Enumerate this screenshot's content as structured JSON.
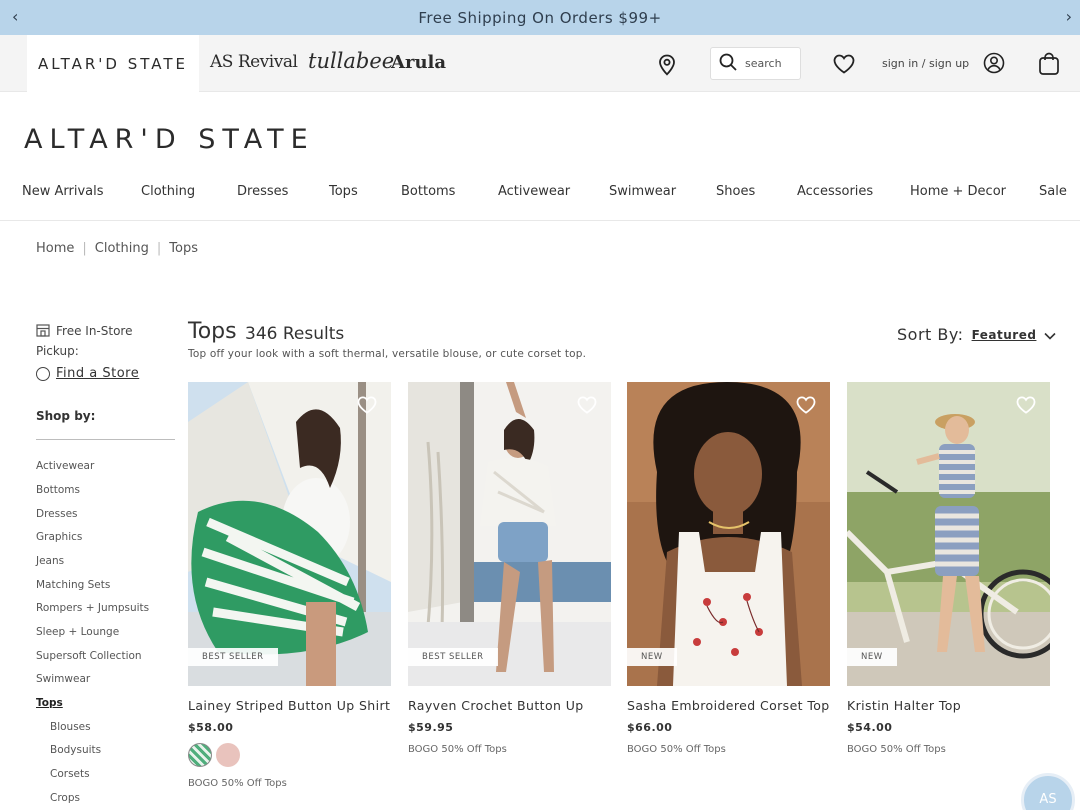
{
  "promo": {
    "text": "Free Shipping On Orders $99+",
    "prev_icon": "chevron-left-icon",
    "next_icon": "chevron-right-icon"
  },
  "brands": {
    "active": "ALTAR'D STATE",
    "revival": "AS Revival",
    "tullabee": "tullabee",
    "arula": "Arula"
  },
  "header": {
    "search_placeholder": "search",
    "signin": "sign in / sign up"
  },
  "logo": "ALTAR'D STATE",
  "nav": [
    "New Arrivals",
    "Clothing",
    "Dresses",
    "Tops",
    "Bottoms",
    "Activewear",
    "Swimwear",
    "Shoes",
    "Accessories",
    "Home + Decor",
    "Sale"
  ],
  "breadcrumb": [
    "Home",
    "Clothing",
    "Tops"
  ],
  "sidebar": {
    "pickup": "Free In-Store Pickup:",
    "find_store": "Find a Store",
    "shop_by": "Shop by:",
    "items": [
      "Activewear",
      "Bottoms",
      "Dresses",
      "Graphics",
      "Jeans",
      "Matching Sets",
      "Rompers + Jumpsuits",
      "Sleep + Lounge",
      "Supersoft Collection",
      "Swimwear",
      "Tops",
      "Blouses",
      "Bodysuits",
      "Corsets",
      "Crops"
    ],
    "active_item": "Tops"
  },
  "page": {
    "title": "Tops",
    "count": "346 Results",
    "description": "Top off your look with a soft thermal, versatile blouse, or cute corset top.",
    "sort_label": "Sort By:",
    "sort_value": "Featured"
  },
  "products": [
    {
      "name": "Lainey Striped Button Up Shirt",
      "price": "$58.00",
      "badge": "BEST SELLER",
      "promo": "BOGO 50% Off Tops",
      "swatches": [
        "#4fae7c",
        "#e9c3bd"
      ]
    },
    {
      "name": "Rayven Crochet Button Up",
      "price": "$59.95",
      "badge": "BEST SELLER",
      "promo": "BOGO 50% Off Tops"
    },
    {
      "name": "Sasha Embroidered Corset Top",
      "price": "$66.00",
      "badge": "NEW",
      "promo": "BOGO 50% Off Tops"
    },
    {
      "name": "Kristin Halter Top",
      "price": "$54.00",
      "badge": "NEW",
      "promo": "BOGO 50% Off Tops"
    }
  ],
  "chat": "AS",
  "colors": {
    "promo_bg": "#b8d4ea",
    "brand_bar": "#f4f4f4",
    "text": "#333333"
  }
}
